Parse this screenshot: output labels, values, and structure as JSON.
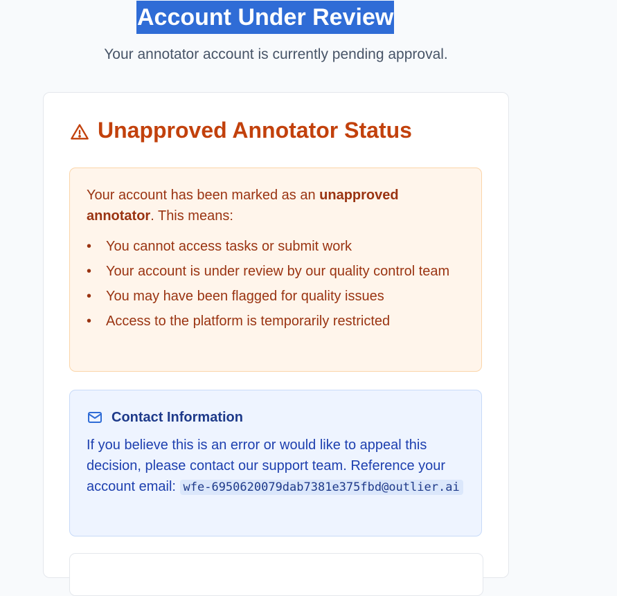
{
  "header": {
    "title": "Account Under Review",
    "subtitle": "Your annotator account is currently pending approval."
  },
  "status_card": {
    "icon": "warning-triangle-icon",
    "title": "Unapproved Annotator Status",
    "warning": {
      "intro_prefix": "Your account has been marked as an ",
      "intro_bold": "unapproved annotator",
      "intro_suffix": ". This means:",
      "bullet": "•",
      "items": [
        "You cannot access tasks or submit work",
        "Your account is under review by our quality control team",
        "You may have been flagged for quality issues",
        "Access to the platform is temporarily restricted"
      ]
    },
    "contact": {
      "icon": "mail-icon",
      "heading": "Contact Information",
      "text": "If you believe this is an error or would like to appeal this decision, please contact our support team. Reference your account email: ",
      "email": "wfe-6950620079dab7381e375fbd@outlier.ai"
    }
  },
  "colors": {
    "accent_title_bg": "#2f6cd6",
    "warning_text": "#c2410c",
    "warning_bg": "#fff5eb",
    "info_text": "#1e40af",
    "info_bg": "#eef4ff"
  }
}
